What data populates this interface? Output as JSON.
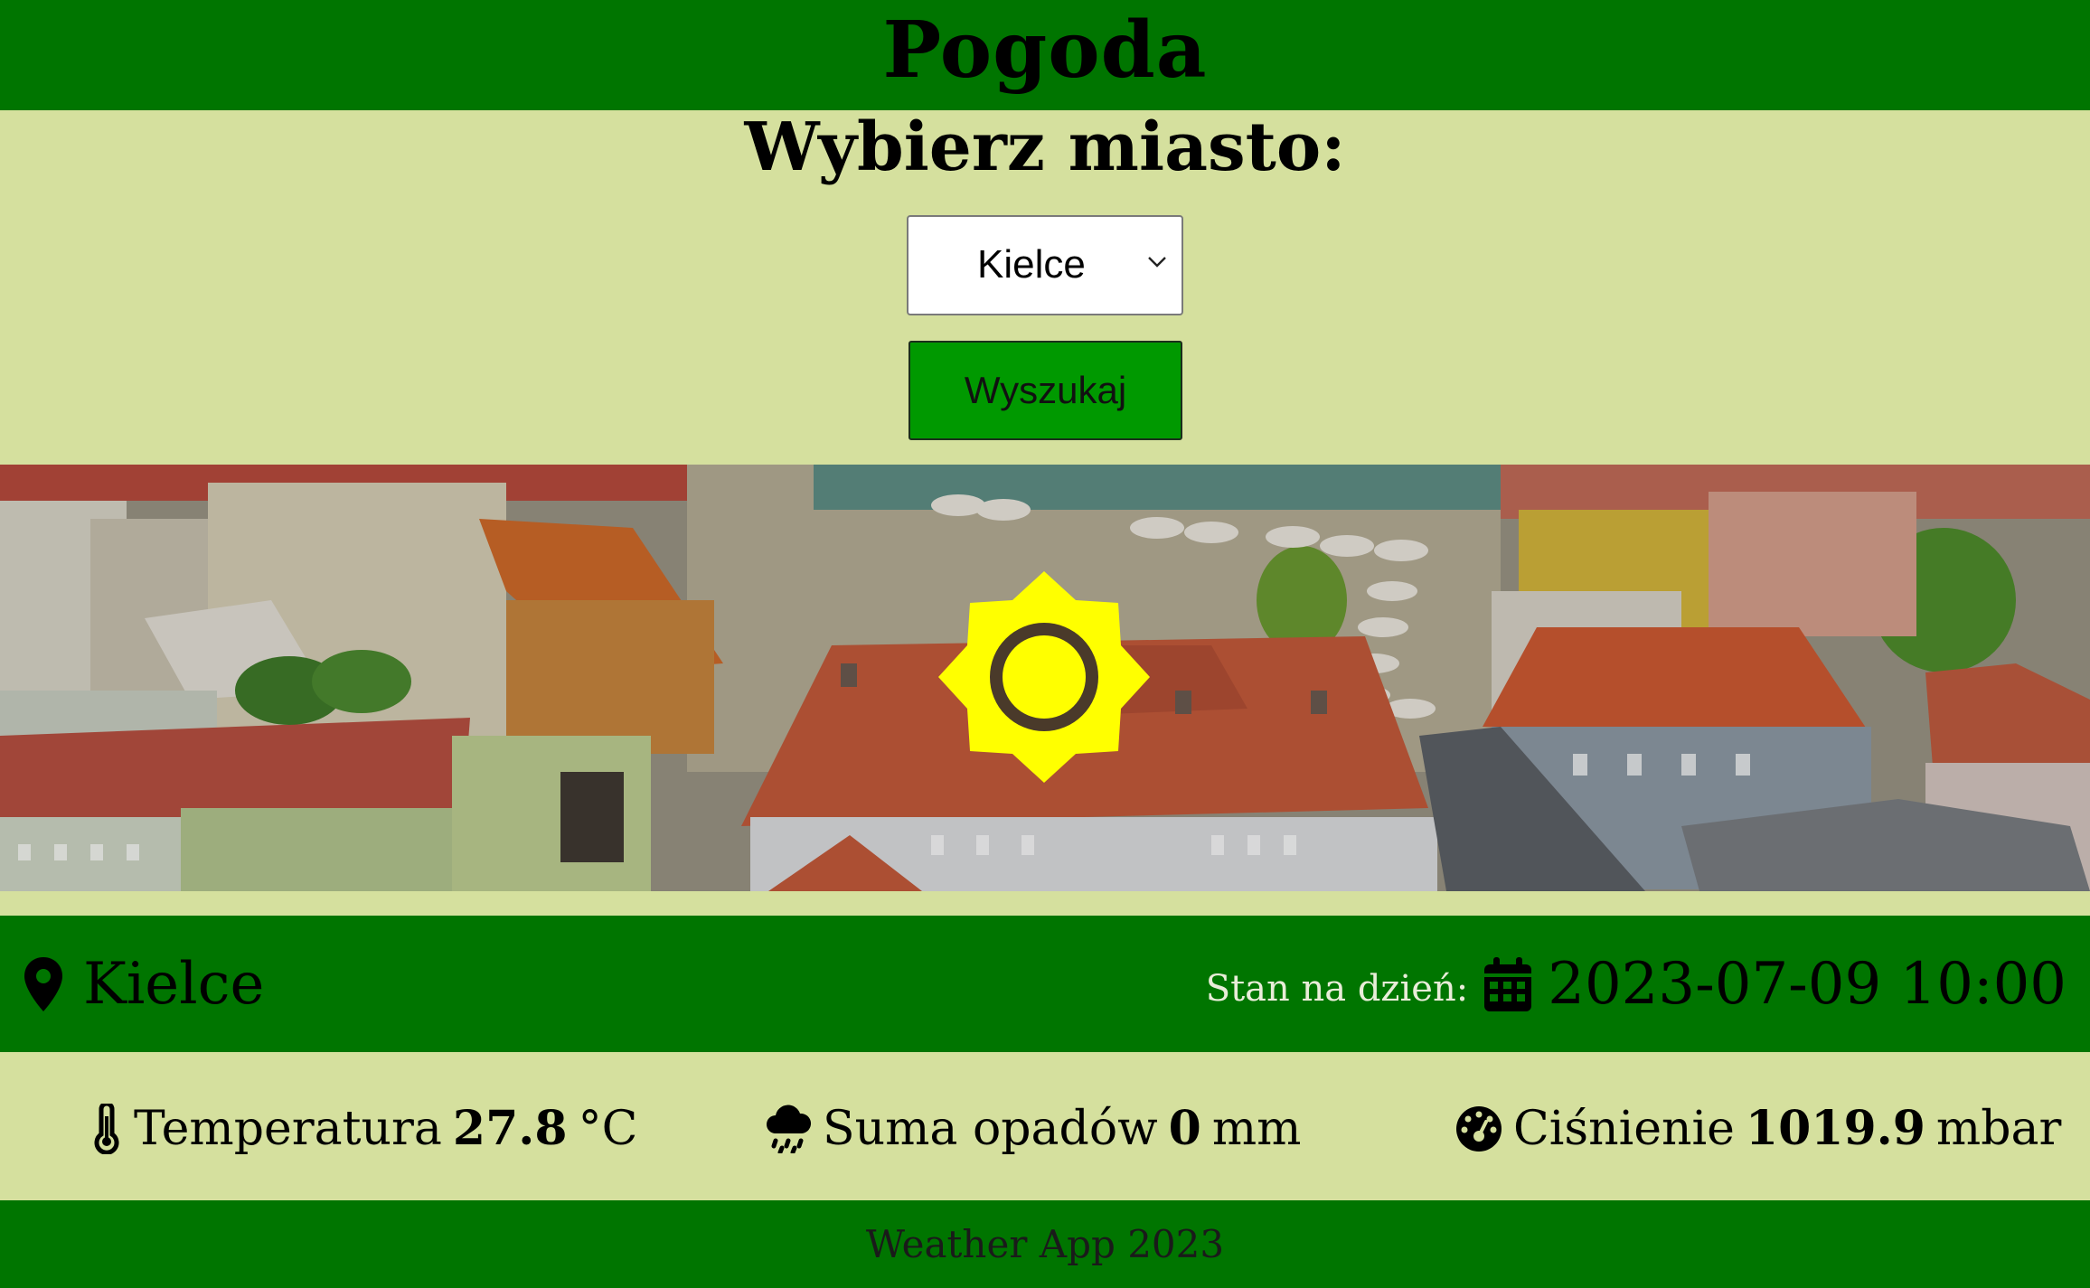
{
  "header": {
    "title": "Pogoda"
  },
  "form": {
    "heading": "Wybierz miasto:",
    "city_select_value": "Kielce",
    "search_button_label": "Wyszukaj"
  },
  "banner": {
    "weather_icon": "sun-icon"
  },
  "location": {
    "city": "Kielce",
    "date_label": "Stan na dzień:",
    "date_value": "2023-07-09 10:00"
  },
  "stats": {
    "temperature": {
      "label": "Temperatura",
      "value": "27.8",
      "unit": "°C",
      "icon": "thermometer-icon"
    },
    "precipitation": {
      "label": "Suma opadów",
      "value": "0",
      "unit": "mm",
      "icon": "cloud-rain-icon"
    },
    "pressure": {
      "label": "Ciśnienie",
      "value": "1019.9",
      "unit": "mbar",
      "icon": "gauge-icon"
    }
  },
  "footer": {
    "text": "Weather App 2023"
  },
  "colors": {
    "header_bg": "#007500",
    "page_bg": "#d5e09e",
    "button_bg": "#009900",
    "sun": "#ffff00"
  }
}
